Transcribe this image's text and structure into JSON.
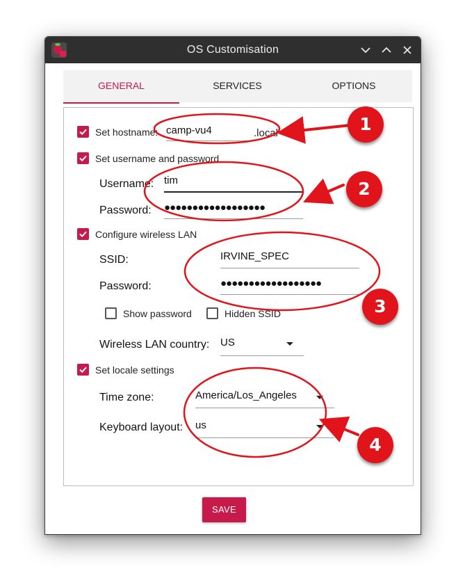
{
  "window": {
    "title": "OS Customisation"
  },
  "tabs": [
    {
      "label": "GENERAL",
      "active": true
    },
    {
      "label": "SERVICES",
      "active": false
    },
    {
      "label": "OPTIONS",
      "active": false
    }
  ],
  "general": {
    "hostname": {
      "label": "Set hostname:",
      "value": "camp-vu4",
      "suffix": ".local",
      "checked": true
    },
    "user": {
      "label": "Set username and password",
      "checked": true,
      "username_label": "Username:",
      "username": "tim",
      "password_label": "Password:",
      "password_mask": "●●●●●●●●●●●●●●●●●●"
    },
    "wifi": {
      "label": "Configure wireless LAN",
      "checked": true,
      "ssid_label": "SSID:",
      "ssid": "IRVINE_SPEC",
      "password_label": "Password:",
      "password_mask": "●●●●●●●●●●●●●●●●●●",
      "show_password": "Show password",
      "show_password_checked": false,
      "hidden_ssid": "Hidden SSID",
      "hidden_ssid_checked": false,
      "country_label": "Wireless LAN country:",
      "country": "US"
    },
    "locale": {
      "label": "Set locale settings",
      "checked": true,
      "timezone_label": "Time zone:",
      "timezone": "America/Los_Angeles",
      "keyboard_label": "Keyboard layout:",
      "keyboard": "us"
    }
  },
  "save_label": "SAVE",
  "annotations": [
    "1",
    "2",
    "3",
    "4"
  ],
  "colors": {
    "accent": "#c51a4a",
    "titlebar": "#2f2f2f",
    "annotation_red": "#e0141a"
  }
}
